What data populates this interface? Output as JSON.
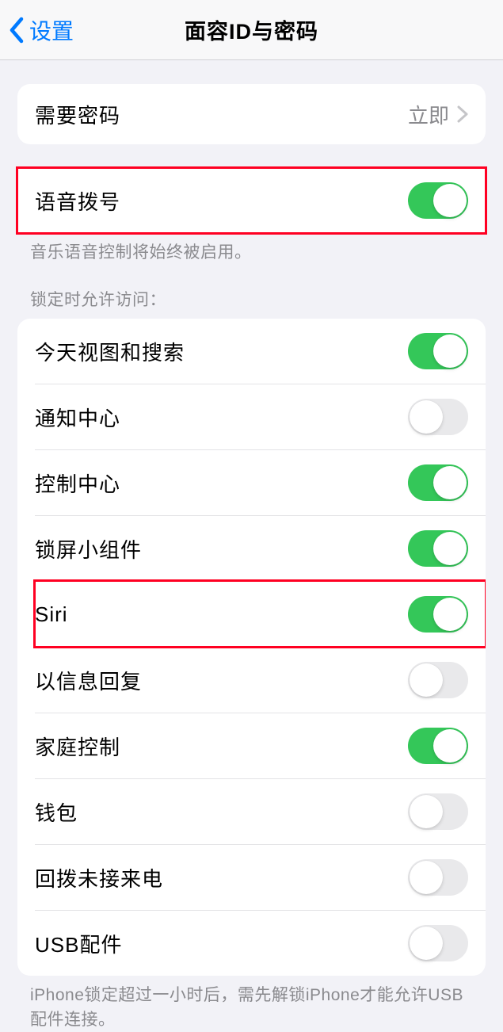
{
  "nav": {
    "back_label": "设置",
    "title": "面容ID与密码"
  },
  "passcode_group": {
    "require_passcode": {
      "label": "需要密码",
      "value": "立即"
    }
  },
  "voice_dial": {
    "label": "语音拨号",
    "on": true,
    "footer": "音乐语音控制将始终被启用。"
  },
  "lock_access": {
    "header": "锁定时允许访问：",
    "items": [
      {
        "label": "今天视图和搜索",
        "on": true,
        "highlighted": false
      },
      {
        "label": "通知中心",
        "on": false,
        "highlighted": false
      },
      {
        "label": "控制中心",
        "on": true,
        "highlighted": false
      },
      {
        "label": "锁屏小组件",
        "on": true,
        "highlighted": false
      },
      {
        "label": "Siri",
        "on": true,
        "highlighted": true
      },
      {
        "label": "以信息回复",
        "on": false,
        "highlighted": false
      },
      {
        "label": "家庭控制",
        "on": true,
        "highlighted": false
      },
      {
        "label": "钱包",
        "on": false,
        "highlighted": false
      },
      {
        "label": "回拨未接来电",
        "on": false,
        "highlighted": false
      },
      {
        "label": "USB配件",
        "on": false,
        "highlighted": false
      }
    ],
    "footer": "iPhone锁定超过一小时后，需先解锁iPhone才能允许USB配件连接。"
  }
}
